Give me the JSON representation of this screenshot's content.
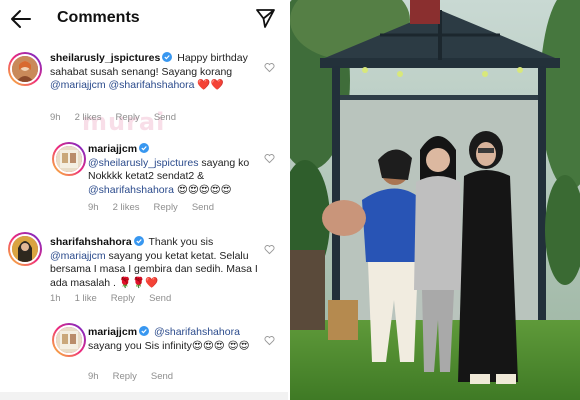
{
  "header": {
    "title": "Comments"
  },
  "watermark": "murai",
  "comments": [
    {
      "username": "sheilarusly_jspictures",
      "text_parts": [
        "Happy birthday sahabat susah senang! Sayang korang ",
        "@mariajjcm",
        " ",
        "@sharifahshahora",
        " ❤️❤️"
      ],
      "time": "9h",
      "likes": "2 likes",
      "reply": "Reply",
      "send": "Send"
    },
    {
      "username": "mariajjcm",
      "text_parts": [
        "@sheilarusly_jspictures",
        " sayang ko Nokkkk ketat2 sendat2 & ",
        "@sharifahshahora",
        " 😍😍😍😍😍"
      ],
      "time": "9h",
      "likes": "2 likes",
      "reply": "Reply",
      "send": "Send"
    },
    {
      "username": "sharifahshahora",
      "text_parts": [
        "Thank you sis ",
        "@mariajjcm",
        " sayang you ketat ketat. Selalu bersama I masa I gembira dan sedih. Masa I ada masalah . 🌹🌹❤️"
      ],
      "time": "1h",
      "likes": "1 like",
      "reply": "Reply",
      "send": "Send"
    },
    {
      "username": "mariajjcm",
      "text_parts": [
        "@sharifahshahora",
        " sayang you Sis infinity😍😍😍 😍😍"
      ],
      "time": "9h",
      "reply": "Reply",
      "send": "Send"
    }
  ],
  "icons": [
    "back-arrow-icon",
    "send-icon",
    "verified-badge-icon",
    "heart-icon"
  ],
  "colors": {
    "mention": "#2b4b8c",
    "meta": "#8e8e8e",
    "verified": "#3897f0"
  }
}
